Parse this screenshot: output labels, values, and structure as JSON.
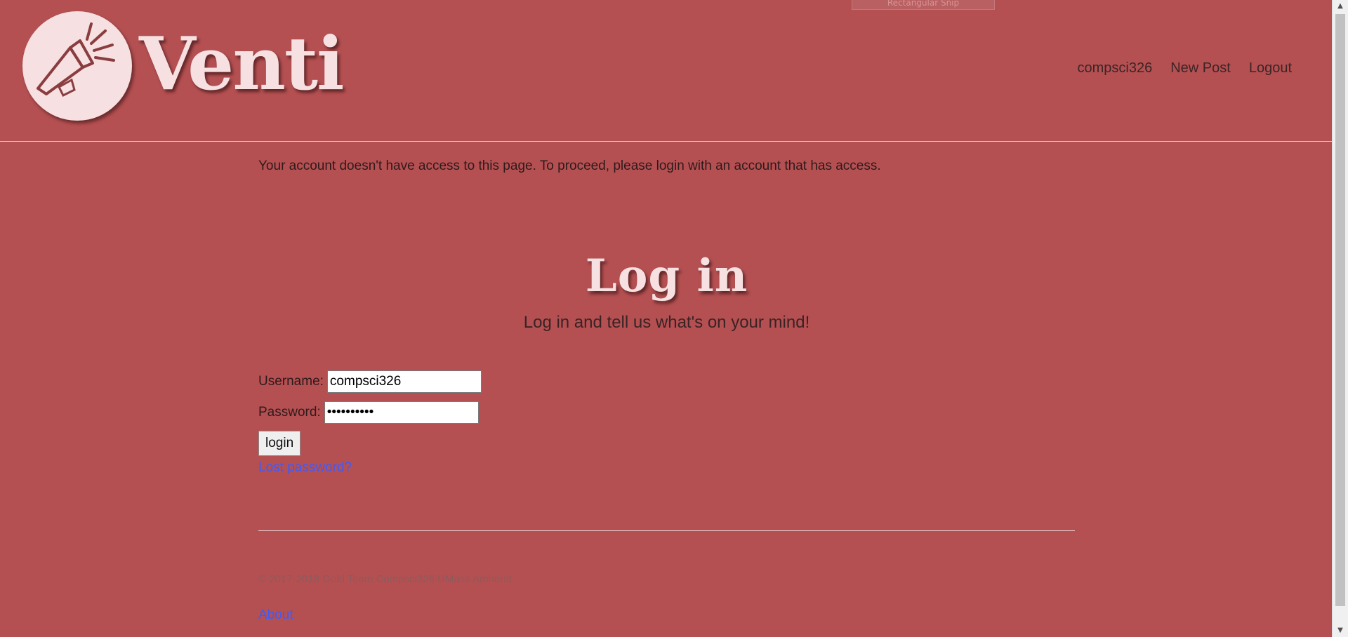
{
  "header": {
    "ghost_tab": "Rectangular Snip",
    "brand": "Venti",
    "nav": [
      {
        "label": "compsci326"
      },
      {
        "label": "New Post"
      },
      {
        "label": "Logout"
      }
    ]
  },
  "main": {
    "notice": "Your account doesn't have access to this page. To proceed, please login with an account that has access.",
    "title": "Log in",
    "subtitle": "Log in and tell us what's on your mind!",
    "form": {
      "username_label": "Username:",
      "username_value": "compsci326",
      "password_label": "Password:",
      "password_value": "••••••••••",
      "login_label": "login",
      "lost_password": "Lost password?"
    }
  },
  "footer": {
    "copyright": "© 2017-2018 Gold Team Compsci326 UMass Amherst",
    "about": "About"
  },
  "colors": {
    "background": "#b55052",
    "logo_fill": "#f6e0e1",
    "link": "#3b5bff"
  },
  "icons": {
    "logo": "megaphone-icon",
    "scroll_up": "chevron-up-icon",
    "scroll_down": "chevron-down-icon"
  }
}
